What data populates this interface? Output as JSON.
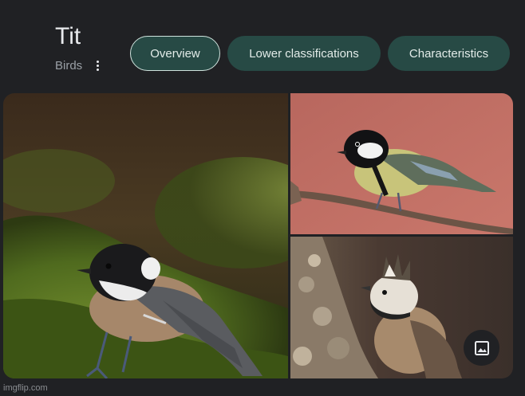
{
  "entity": {
    "title": "Tit",
    "subtitle": "Birds"
  },
  "chips": [
    {
      "label": "Overview",
      "active": true
    },
    {
      "label": "Lower classifications",
      "active": false
    },
    {
      "label": "Characteristics",
      "active": false
    }
  ],
  "images": [
    {
      "subject": "coal tit on moss"
    },
    {
      "subject": "great tit on branch"
    },
    {
      "subject": "crested tit on lichen trunk"
    }
  ],
  "icons": {
    "more": "more-vert-icon",
    "image": "image-icon"
  },
  "colors": {
    "background": "#202124",
    "chip": "#274a45",
    "chip_text": "#e3ece9"
  },
  "watermark": "imgflip.com"
}
